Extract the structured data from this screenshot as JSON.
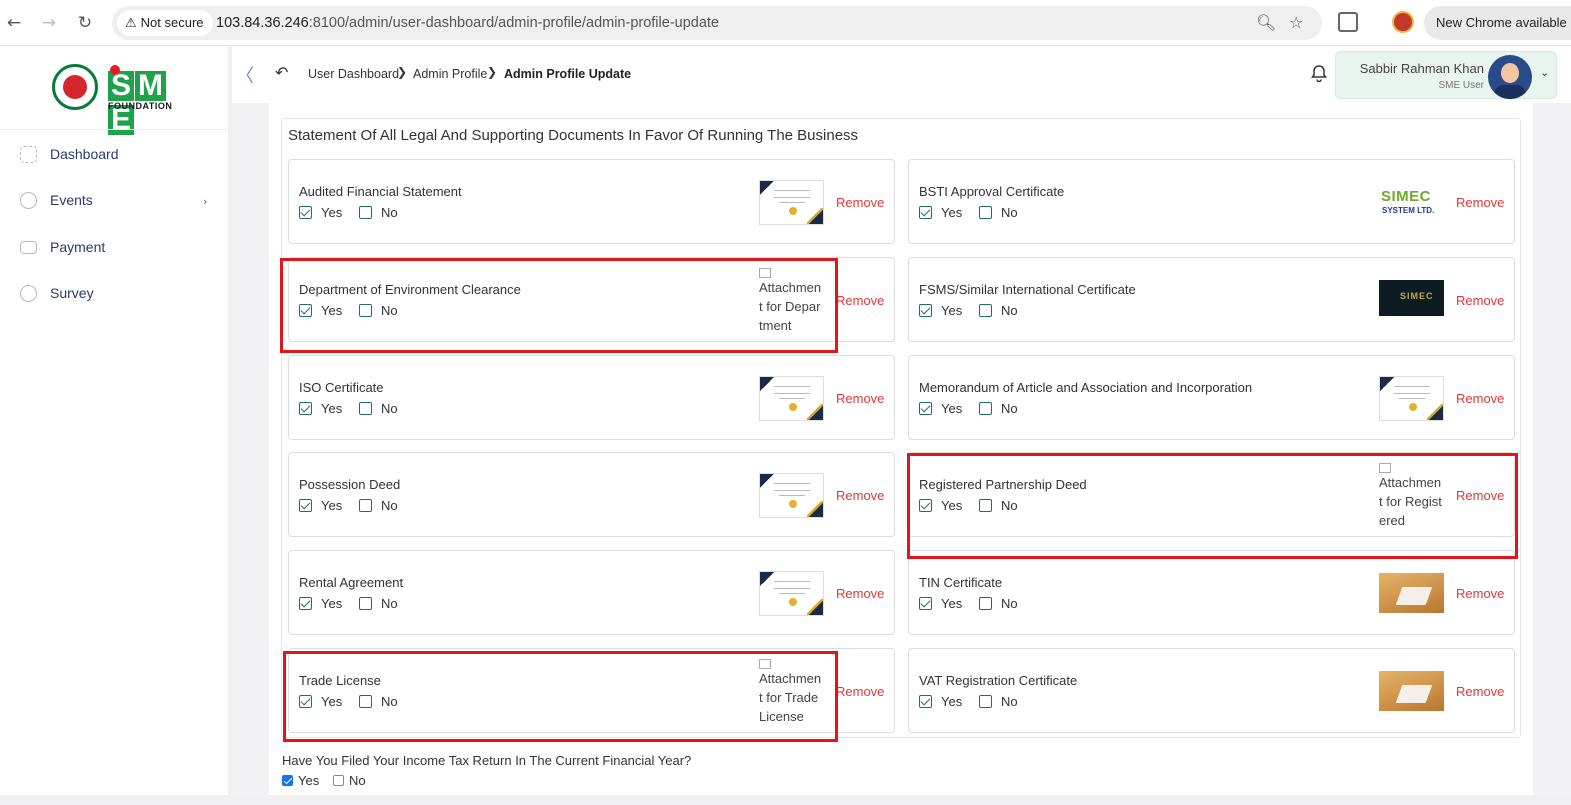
{
  "browser": {
    "not_secure": "Not secure",
    "url_host": "103.84.36.246",
    "url_rest": ":8100/admin/user-dashboard/admin-profile/admin-profile-update",
    "new_chrome": "New Chrome available"
  },
  "brand": {
    "letters": [
      "S",
      "M",
      "E"
    ],
    "sub": "FOUNDATION"
  },
  "sidebar": {
    "items": [
      {
        "label": "Dashboard",
        "icon": "grid-icon"
      },
      {
        "label": "Events",
        "icon": "shield-icon"
      },
      {
        "label": "Payment",
        "icon": "payment-icon"
      },
      {
        "label": "Survey",
        "icon": "pie-chart-icon"
      }
    ]
  },
  "breadcrumb": [
    "User Dashboard",
    "Admin Profile",
    "Admin Profile Update"
  ],
  "user": {
    "name": "Sabbir Rahman Khan",
    "role": "SME User"
  },
  "section": {
    "title": "Statement Of All Legal And Supporting Documents In Favor Of Running The Business"
  },
  "labels": {
    "yes": "Yes",
    "no": "No",
    "remove": "Remove"
  },
  "documents": [
    {
      "title": "Audited Financial Statement",
      "yes": true,
      "no": false,
      "thumb": "certificate"
    },
    {
      "title": "BSTI Approval Certificate",
      "yes": true,
      "no": false,
      "thumb": "simec",
      "thumb_text": [
        "SIMEC",
        "SYSTEM LTD."
      ]
    },
    {
      "title": "Department of Environment Clearance",
      "yes": true,
      "no": false,
      "thumb": "broken",
      "alt": "Attachment for Department"
    },
    {
      "title": "FSMS/Similar International Certificate",
      "yes": true,
      "no": false,
      "thumb": "dark",
      "thumb_text": [
        "SIMEC"
      ]
    },
    {
      "title": "ISO Certificate",
      "yes": true,
      "no": false,
      "thumb": "certificate"
    },
    {
      "title": "Memorandum of Article and Association and Incorporation",
      "yes": true,
      "no": false,
      "thumb": "certificate"
    },
    {
      "title": "Possession Deed",
      "yes": true,
      "no": false,
      "thumb": "certificate"
    },
    {
      "title": "Registered Partnership Deed",
      "yes": true,
      "no": false,
      "thumb": "broken",
      "alt": "Attachment for Registered"
    },
    {
      "title": "Rental Agreement",
      "yes": true,
      "no": false,
      "thumb": "certificate"
    },
    {
      "title": "TIN Certificate",
      "yes": true,
      "no": false,
      "thumb": "desk"
    },
    {
      "title": "Trade License",
      "yes": true,
      "no": false,
      "thumb": "broken",
      "alt": "Attachment for Trade License"
    },
    {
      "title": "VAT Registration Certificate",
      "yes": true,
      "no": false,
      "thumb": "desk"
    }
  ],
  "tax_question": {
    "text": "Have You Filed Your Income Tax Return In The Current Financial Year?",
    "yes": true,
    "no": false
  },
  "colors": {
    "accent": "#1e6f6a",
    "remove": "#e03838",
    "highlight": "#e0161d",
    "brand_green": "#1ea34b"
  }
}
